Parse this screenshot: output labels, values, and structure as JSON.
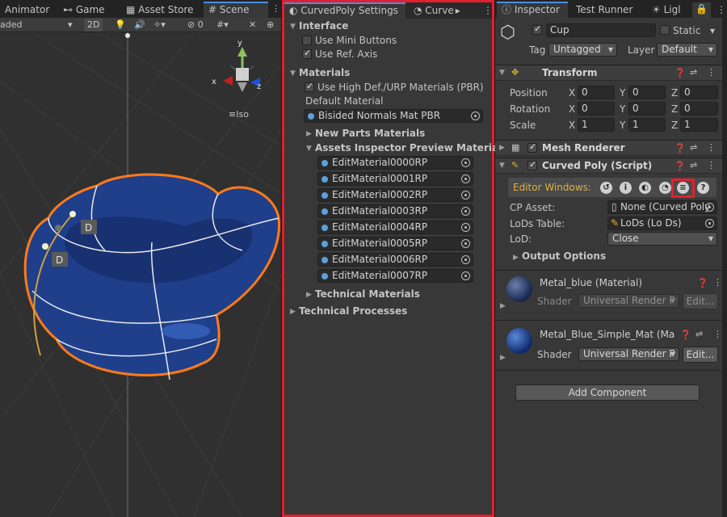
{
  "scene": {
    "tabs": [
      {
        "label": "Animator"
      },
      {
        "label": "Game"
      },
      {
        "label": "Asset Store"
      },
      {
        "label": "Scene"
      }
    ],
    "shading_mode": "aded",
    "toggle_2d": "2D",
    "hidden_count": "0",
    "projection_label": "Iso",
    "axes": {
      "x": "x",
      "y": "y",
      "z": "z"
    },
    "point_labels": [
      "D",
      "D"
    ]
  },
  "settings": {
    "tabs": [
      {
        "label": "CurvedPoly Settings"
      },
      {
        "label": "Curve"
      }
    ],
    "interface": {
      "title": "Interface",
      "use_mini_buttons": "Use Mini Buttons",
      "use_ref_axis": "Use Ref. Axis"
    },
    "materials": {
      "title": "Materials",
      "use_high_def": "Use High Def./URP Materials (PBR)",
      "default_material_label": "Default Material",
      "default_material_value": "Bisided Normals Mat PBR",
      "new_parts": "New Parts Materials",
      "preview_title": "Assets Inspector Preview Materials",
      "preview_items": [
        "EditMaterial0000RP",
        "EditMaterial0001RP",
        "EditMaterial0002RP",
        "EditMaterial0003RP",
        "EditMaterial0004RP",
        "EditMaterial0005RP",
        "EditMaterial0006RP",
        "EditMaterial0007RP"
      ],
      "technical": "Technical Materials"
    },
    "technical_processes": "Technical Processes"
  },
  "inspector": {
    "tabs": [
      {
        "label": "Inspector"
      },
      {
        "label": "Test Runner"
      },
      {
        "label": "Ligl"
      }
    ],
    "object": {
      "name": "Cup",
      "static_label": "Static",
      "tag_label": "Tag",
      "tag_value": "Untagged",
      "layer_label": "Layer",
      "layer_value": "Default"
    },
    "transform": {
      "title": "Transform",
      "rows": [
        {
          "label": "Position",
          "x": "0",
          "y": "0",
          "z": "0"
        },
        {
          "label": "Rotation",
          "x": "0",
          "y": "0",
          "z": "0"
        },
        {
          "label": "Scale",
          "x": "1",
          "y": "1",
          "z": "1"
        }
      ],
      "axis_x": "X",
      "axis_y": "Y",
      "axis_z": "Z"
    },
    "mesh_renderer": {
      "title": "Mesh Renderer"
    },
    "curved_poly": {
      "title": "Curved Poly (Script)",
      "editor_windows_label": "Editor Windows:",
      "cp_asset_label": "CP Asset:",
      "cp_asset_value": "None (Curved Poly",
      "lods_table_label": "LoDs Table:",
      "lods_table_value": "LoDs (Lo Ds)",
      "lod_label": "LoD:",
      "lod_value": "Close",
      "output_options": "Output Options"
    },
    "materials": [
      {
        "name": "Metal_blue (Material)",
        "shader_label": "Shader",
        "shader_value": "Universal Render P",
        "edit_label": "Edit..."
      },
      {
        "name": "Metal_Blue_Simple_Mat (Ma",
        "shader_label": "Shader",
        "shader_value": "Universal Render P",
        "edit_label": "Edit..."
      }
    ],
    "add_component": "Add Component"
  },
  "colors": {
    "highlight": "#e02030",
    "selection_outline": "#ff7a1a",
    "mesh_blue": "#1f3f8a",
    "accent": "#4a8fe0"
  }
}
